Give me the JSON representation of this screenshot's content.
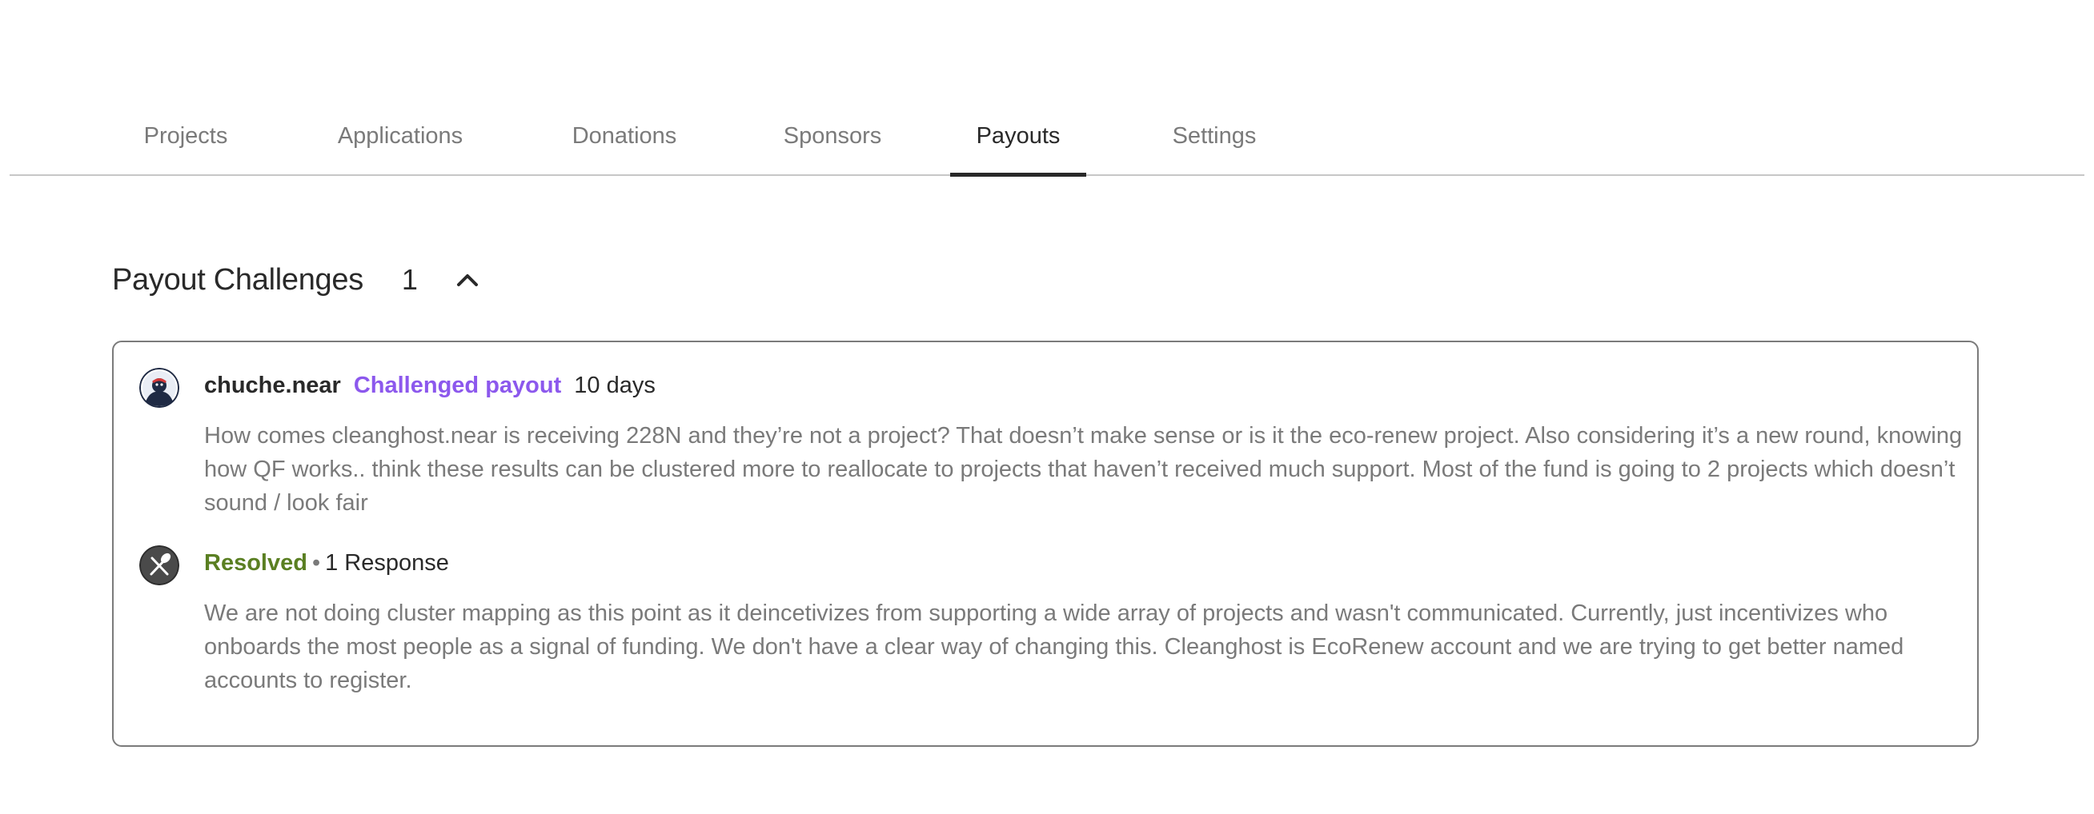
{
  "tabs": [
    {
      "label": "Projects",
      "active": false
    },
    {
      "label": "Applications",
      "active": false
    },
    {
      "label": "Donations",
      "active": false
    },
    {
      "label": "Sponsors",
      "active": false
    },
    {
      "label": "Payouts",
      "active": true
    },
    {
      "label": "Settings",
      "active": false
    }
  ],
  "section": {
    "title": "Payout Challenges",
    "count": "1",
    "toggle_icon": "chevron-up-icon"
  },
  "challenge": {
    "username": "chuche.near",
    "action": "Challenged payout",
    "time": "10 days",
    "text": "How comes cleanghost.near is receiving 228N and they’re not a project? That doesn’t make sense or is it the eco-renew project. Also considering it’s a new round, knowing how QF works.. think these results can be clustered more to reallocate to projects that haven’t received much support. Most of the fund is going to 2 projects which doesn’t sound / look fair"
  },
  "response": {
    "status": "Resolved",
    "separator": "•",
    "responses": "1 Response",
    "text": "We are not doing cluster mapping as this point as it deincetivizes from supporting a wide array of projects and wasn't communicated. Currently, just incentivizes who onboards the most people as a signal of funding. We don't have a clear way of changing this. Cleanghost is EcoRenew account and we are trying to get better named accounts to register."
  },
  "colors": {
    "accent_purple": "#8c58ed",
    "resolved_green": "#5a7f22",
    "muted_text": "#7a7a7a",
    "primary_text": "#292929"
  }
}
